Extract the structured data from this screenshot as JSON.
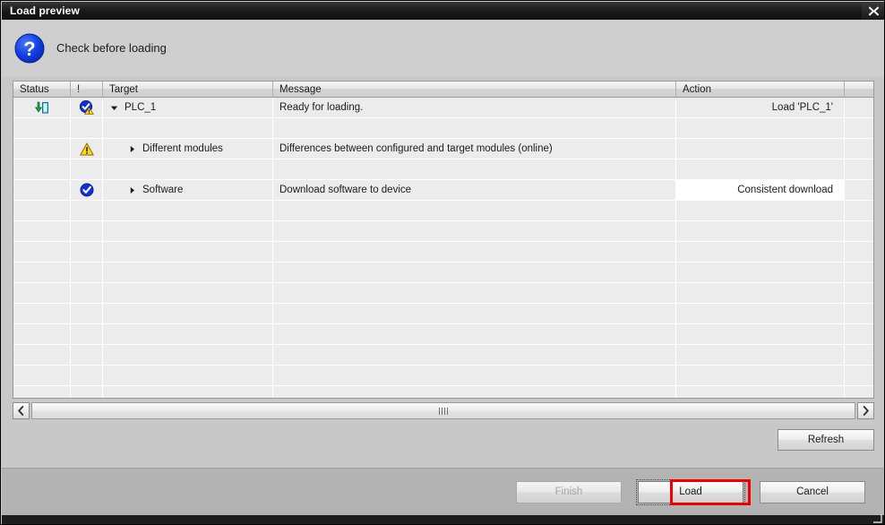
{
  "window": {
    "title": "Load preview",
    "close_icon": "close-icon"
  },
  "header": {
    "icon": "question-mark-icon",
    "label": "Check before loading"
  },
  "table": {
    "columns": [
      {
        "key": "status",
        "label": "Status"
      },
      {
        "key": "excl",
        "label": "!"
      },
      {
        "key": "target",
        "label": "Target"
      },
      {
        "key": "message",
        "label": "Message"
      },
      {
        "key": "action",
        "label": "Action"
      }
    ],
    "rows": [
      {
        "status_icon": "download-to-device-icon",
        "flag_icon": "ok-with-warning-icon",
        "expander": "triangle-down-icon",
        "target": "PLC_1",
        "message": "Ready for loading.",
        "action": "Load 'PLC_1'",
        "action_style": "plain"
      },
      {
        "status_icon": "",
        "flag_icon": "warning-triangle-icon",
        "expander": "triangle-right-icon",
        "target": "Different modules",
        "message": "Differences between configured and target modules (online)",
        "action": "",
        "action_style": "plain"
      },
      {
        "status_icon": "",
        "flag_icon": "ok-check-icon",
        "expander": "triangle-right-icon",
        "target": "Software",
        "message": "Download software to device",
        "action": "Consistent download",
        "action_style": "dropdown"
      }
    ]
  },
  "scrollbar": {
    "left_icon": "chevron-left-icon",
    "right_icon": "chevron-right-icon",
    "grip_icon": "grip-icon"
  },
  "buttons": {
    "refresh": "Refresh",
    "finish": "Finish",
    "load": "Load",
    "cancel": "Cancel"
  },
  "colors": {
    "highlight": "#ee0000",
    "titlebar": "#141414",
    "dialog_bg": "#c8c8c8"
  }
}
